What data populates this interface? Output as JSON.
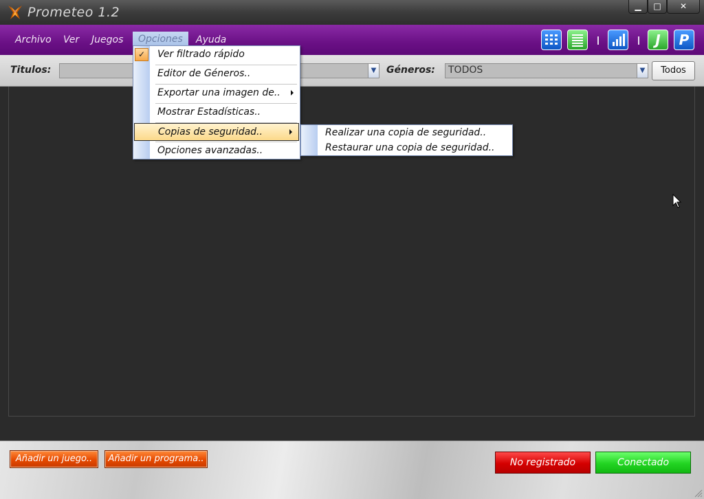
{
  "window": {
    "title": "Prometeo 1.2",
    "controls": {
      "minimize": "▁",
      "maximize": "□",
      "close": "✕"
    }
  },
  "menubar": {
    "items": [
      "Archivo",
      "Ver",
      "Juegos",
      "Opciones",
      "Ayuda"
    ],
    "active": "Opciones",
    "tools": [
      {
        "icon": "grid-view-icon",
        "color": "#1f6ed4"
      },
      {
        "icon": "list-view-icon",
        "color": "#3fbf3f"
      },
      {
        "icon": "statistics-icon",
        "color": "#1f6ed4"
      },
      {
        "icon": "games-j-icon",
        "color": "#3fbf3f"
      },
      {
        "icon": "programs-p-icon",
        "color": "#1f6ed4"
      }
    ],
    "tool_letters": {
      "j": "J",
      "p": "P"
    }
  },
  "filterbar": {
    "titles_label": "Titulos:",
    "titles_value": "",
    "genres_label": "Géneros:",
    "genres_value": "TODOS",
    "all_button": "Todos"
  },
  "options_menu": {
    "items": [
      {
        "label": "Ver filtrado rápido",
        "checked": true
      },
      {
        "label": "Editor de Géneros.."
      },
      {
        "label": "Exportar una imagen de..",
        "submenu": true
      },
      {
        "label": "Mostrar Estadísticas.."
      },
      {
        "label": "Copias de seguridad..",
        "submenu": true,
        "highlighted": true
      },
      {
        "label": "Opciones avanzadas.."
      }
    ],
    "check_mark": "✓"
  },
  "backup_submenu": {
    "items": [
      "Realizar una copia de seguridad..",
      "Restaurar una copia de seguridad.."
    ]
  },
  "bottombar": {
    "add_game": "Añadir un juego..",
    "add_program": "Añadir un programa..",
    "status_registration": "No registrado",
    "status_connection": "Conectado"
  }
}
